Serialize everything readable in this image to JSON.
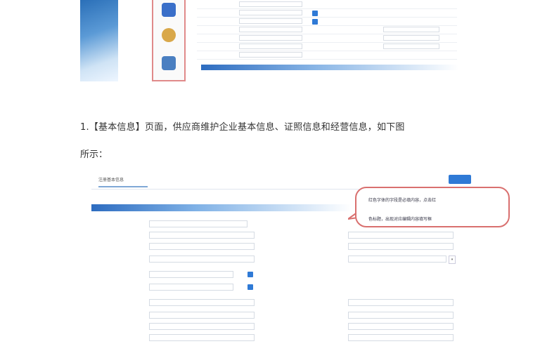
{
  "top_screenshot": {
    "side_icons": [
      {
        "name": "app-icon",
        "label": "",
        "color": "#3a6fc9"
      },
      {
        "name": "user-icon",
        "label": "",
        "color": "#d9a84a"
      },
      {
        "name": "settings-icon",
        "label": "",
        "color": "#4a7fc1"
      }
    ],
    "form_rows": [
      {
        "label": "",
        "value": ""
      },
      {
        "label": "",
        "value": ""
      },
      {
        "label": "",
        "value": ""
      },
      {
        "label": "",
        "value": "",
        "right_label": "",
        "right_value": ""
      },
      {
        "label": "",
        "value": "",
        "right_label": "",
        "right_value": ""
      },
      {
        "label": "",
        "value": "",
        "right_label": "",
        "right_value": ""
      },
      {
        "label": "",
        "value": ""
      }
    ],
    "note": ""
  },
  "paragraph": {
    "line1": "1.【基本信息】页面，供应商维护企业基本信息、证照信息和经营信息，如下图",
    "line2": "所示："
  },
  "lower_screenshot": {
    "tab_label": "注册基本信息",
    "search_button": "",
    "section_title": "",
    "callout": {
      "line1": "红色字体的字段是必填内容，点击红",
      "line2": "色标题，出现对应编辑内容填写框"
    },
    "rows": [
      {
        "label": "",
        "value": "",
        "right_label": "",
        "right_value": ""
      },
      {
        "label": "",
        "value": "",
        "right_label": "",
        "right_value": ""
      },
      {
        "label": "",
        "value": "",
        "right_label": "",
        "right_value": ""
      },
      {
        "label": "",
        "value": "",
        "right_label": "",
        "right_value": ""
      },
      {
        "label": "",
        "value": "",
        "right_label": "",
        "right_value": ""
      },
      {
        "label": "",
        "value": "",
        "right_label": "",
        "right_value": ""
      },
      {
        "label": "",
        "value": "",
        "right_label": "",
        "right_value": ""
      },
      {
        "label": "",
        "value": "",
        "right_label": "",
        "right_value": ""
      },
      {
        "label": "",
        "value": "",
        "right_label": "",
        "right_value": ""
      },
      {
        "label": "",
        "value": "",
        "right_label": "",
        "right_value": ""
      },
      {
        "label": "",
        "value": "",
        "right_label": "",
        "right_value": ""
      },
      {
        "label": "",
        "value": "",
        "right_label": "",
        "right_value": ""
      }
    ],
    "colors": {
      "accent": "#2f7ad6",
      "required": "#dd2222",
      "callout_border": "#d9706f"
    }
  }
}
